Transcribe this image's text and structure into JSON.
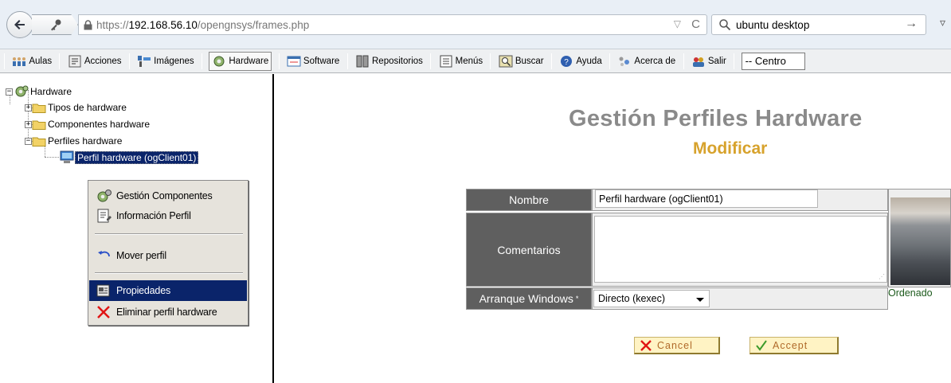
{
  "browser": {
    "url_prefix": "https://",
    "url_host": "192.168.56.10",
    "url_path": "/opengnsys/frames.php",
    "search_text": "ubuntu desktop"
  },
  "menubar": {
    "items": [
      {
        "label": "Aulas",
        "icon": "classroom-icon"
      },
      {
        "label": "Acciones",
        "icon": "actions-icon"
      },
      {
        "label": "Imágenes",
        "icon": "images-icon"
      },
      {
        "label": "Hardware",
        "icon": "hardware-icon"
      },
      {
        "label": "Software",
        "icon": "software-icon"
      },
      {
        "label": "Repositorios",
        "icon": "repositories-icon"
      },
      {
        "label": "Menús",
        "icon": "menus-icon"
      },
      {
        "label": "Buscar",
        "icon": "search-icon"
      },
      {
        "label": "Ayuda",
        "icon": "help-icon"
      },
      {
        "label": "Acerca de",
        "icon": "about-icon"
      },
      {
        "label": "Salir",
        "icon": "exit-icon"
      }
    ],
    "active_item": "Hardware",
    "centro_select": "-- Centro"
  },
  "tree": {
    "root": "Hardware",
    "children": [
      "Tipos de hardware",
      "Componentes hardware",
      "Perfiles hardware"
    ],
    "selected_leaf": "Perfil hardware (ogClient01)"
  },
  "context_menu": {
    "items": [
      "Gestión Componentes",
      "Información Perfil",
      "Mover perfil",
      "Propiedades",
      "Eliminar perfil hardware"
    ],
    "highlighted": "Propiedades"
  },
  "form": {
    "title": "Gestión Perfiles Hardware",
    "subtitle": "Modificar",
    "name_label": "Nombre",
    "name_value": "Perfil hardware (ogClient01)",
    "comments_label": "Comentarios",
    "comments_value": "",
    "boot_label": "Arranque Windows",
    "boot_marker": "*",
    "boot_value": "Directo (kexec)",
    "image_caption": "Ordenado",
    "cancel_label": "Cancel",
    "accept_label": "Accept"
  }
}
